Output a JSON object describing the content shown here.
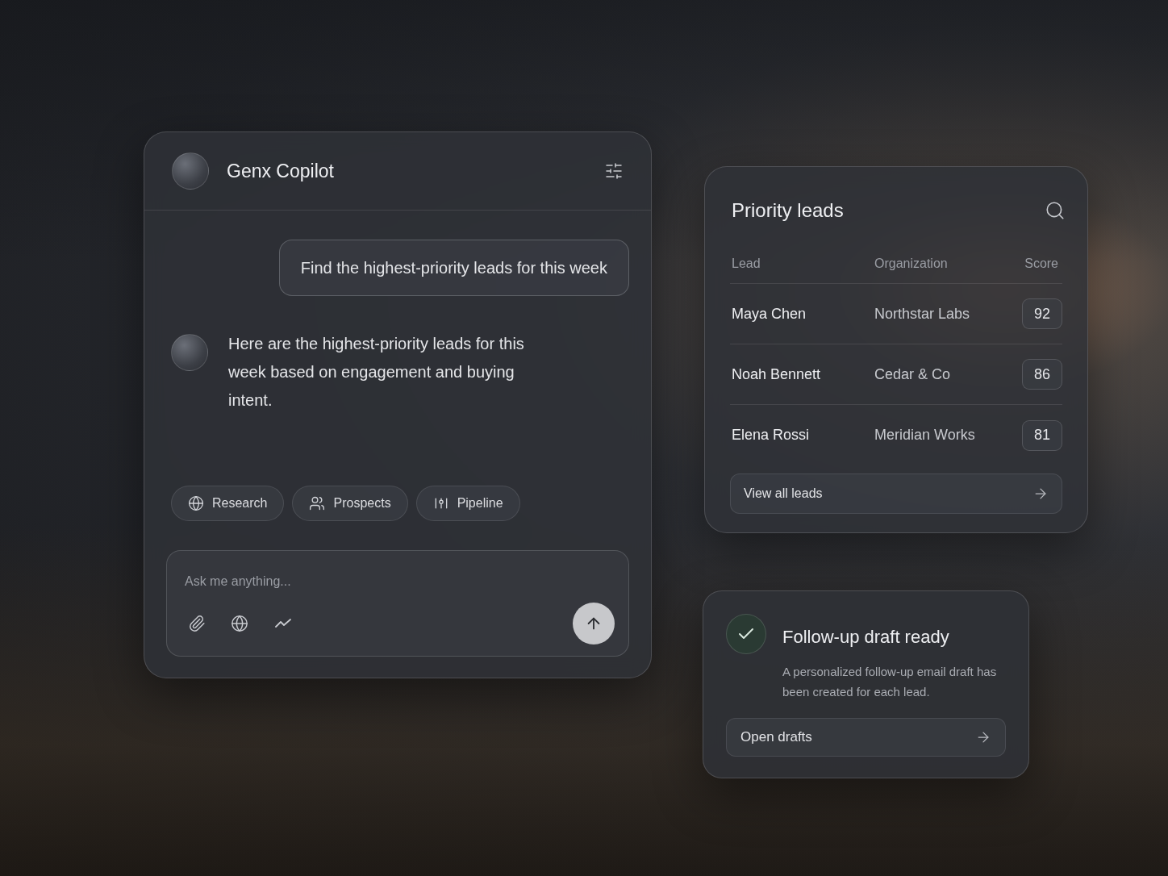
{
  "copilot": {
    "title": "Genx Copilot",
    "user_message": "Find the highest-priority leads for this week",
    "assistant_message": "Here are the highest-priority leads for this week based on engagement and buying intent.",
    "chips": [
      {
        "label": "Research"
      },
      {
        "label": "Prospects"
      },
      {
        "label": "Pipeline"
      }
    ],
    "input": {
      "placeholder": "Ask me anything..."
    }
  },
  "priority_leads": {
    "title": "Priority leads",
    "columns": [
      "Lead",
      "Organization",
      "Score"
    ],
    "rows": [
      {
        "lead": "Maya Chen",
        "organization": "Northstar Labs",
        "score": "92"
      },
      {
        "lead": "Noah Bennett",
        "organization": "Cedar & Co",
        "score": "86"
      },
      {
        "lead": "Elena Rossi",
        "organization": "Meridian Works",
        "score": "81"
      }
    ],
    "link": "View all leads"
  },
  "notification": {
    "title": "Follow-up draft ready",
    "description": "A personalized follow-up email draft has been created for each lead.",
    "button": "Open drafts"
  }
}
